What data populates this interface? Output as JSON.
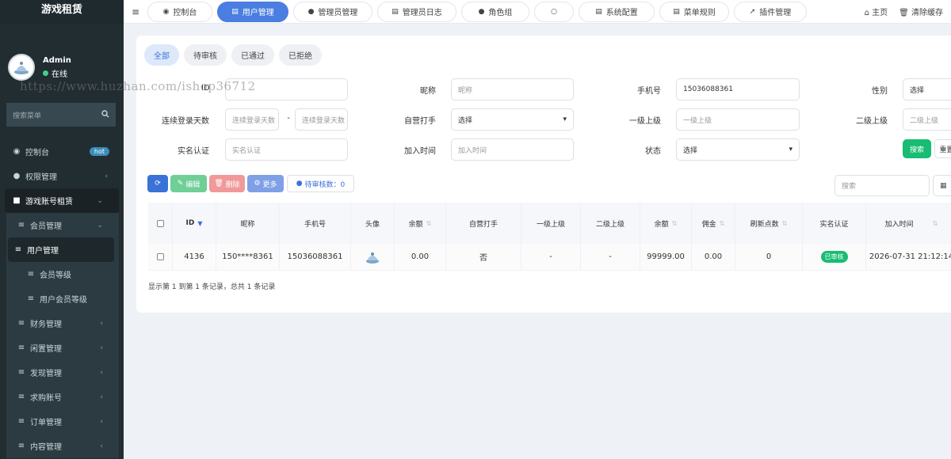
{
  "app": {
    "brand": "游戏租赁"
  },
  "user": {
    "name": "Admin",
    "status": "在线"
  },
  "sidebar": {
    "search_placeholder": "搜索菜单",
    "items": [
      {
        "label": "控制台",
        "icon": "dashboard-icon",
        "badge": "hot"
      },
      {
        "label": "权限管理",
        "icon": "users-icon"
      },
      {
        "label": "游戏账号租赁",
        "icon": "folder-icon"
      },
      {
        "label": "会员管理",
        "icon": "list-icon"
      },
      {
        "label": "用户管理",
        "icon": "list-icon"
      },
      {
        "label": "会员等级",
        "icon": "list-icon"
      },
      {
        "label": "用户会员等级",
        "icon": "list-icon"
      },
      {
        "label": "财务管理",
        "icon": "list-icon"
      },
      {
        "label": "闲置管理",
        "icon": "list-icon"
      },
      {
        "label": "发现管理",
        "icon": "list-icon"
      },
      {
        "label": "求购账号",
        "icon": "list-icon"
      },
      {
        "label": "订单管理",
        "icon": "list-icon"
      },
      {
        "label": "内容管理",
        "icon": "list-icon"
      }
    ]
  },
  "topbar": {
    "tabs": [
      {
        "label": "控制台",
        "icon": "dashboard-icon"
      },
      {
        "label": "用户管理",
        "icon": "list-icon"
      },
      {
        "label": "管理员管理",
        "icon": "user-icon"
      },
      {
        "label": "管理员日志",
        "icon": "list-icon"
      },
      {
        "label": "角色组",
        "icon": "users-icon"
      },
      {
        "label": "",
        "icon": "circle-icon"
      },
      {
        "label": "系统配置",
        "icon": "list-icon"
      },
      {
        "label": "菜单规则",
        "icon": "list-icon"
      },
      {
        "label": "插件管理",
        "icon": "rocket-icon"
      }
    ],
    "home": "主页",
    "clear_cache": "清除缓存"
  },
  "filter": {
    "status_tabs": [
      "全部",
      "待审核",
      "已通过",
      "已拒绝"
    ],
    "id_label": "ID",
    "nickname_label": "昵称",
    "nickname_placeholder": "昵称",
    "phone_label": "手机号",
    "phone_value": "15036088361",
    "gender_label": "性别",
    "gender_value": "选择",
    "login_days_label": "连续登录天数",
    "login_days_placeholder": "连续登录天数",
    "range_sep": "-",
    "self_label": "自营打手",
    "self_value": "选择",
    "level1_label": "一级上级",
    "level1_placeholder": "一级上级",
    "level2_label": "二级上级",
    "level2_placeholder": "二级上级",
    "realname_label": "实名认证",
    "realname_placeholder": "实名认证",
    "jointime_label": "加入时间",
    "jointime_placeholder": "加入时间",
    "state_label": "状态",
    "state_value": "选择",
    "search_btn": "搜索",
    "reset_btn": "重置"
  },
  "toolbar": {
    "edit": "编辑",
    "delete": "删除",
    "more": "更多",
    "pending": "待审核数：0",
    "search_placeholder": "搜索"
  },
  "table": {
    "columns": [
      "ID",
      "昵称",
      "手机号",
      "头像",
      "余额",
      "自营打手",
      "一级上级",
      "二级上级",
      "余额",
      "佣金",
      "刷新点数",
      "实名认证",
      "加入时间"
    ],
    "rows": [
      {
        "id": "4136",
        "nickname": "150****8361",
        "phone": "15036088361",
        "balance": "0.00",
        "self": "否",
        "l1": "-",
        "l2": "-",
        "balance2": "99999.00",
        "commission": "0.00",
        "points": "0",
        "realname": "已审核",
        "jointime": "2026-07-31 21:12:14"
      }
    ],
    "footer": "显示第 1 到第 1 条记录，总共 1 条记录"
  },
  "watermark": "https://www.huzhan.com/ishop36712",
  "colors": {
    "accent": "#4a7ee0",
    "success": "#18bc73",
    "sidebar": "#222d32"
  }
}
